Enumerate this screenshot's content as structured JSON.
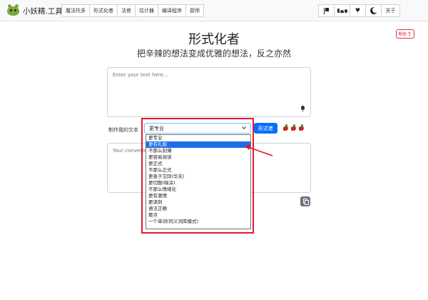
{
  "brand": {
    "name": "小妖精.工具",
    "logo_icon": "alien-logo-icon"
  },
  "nav": {
    "items": [
      "魔法托多",
      "形式化者",
      "法官",
      "估计器",
      "编译程序",
      "厨师"
    ],
    "right": {
      "language_icon": "flag-icon",
      "os_icon": "platforms-icon",
      "heart_icon": "heart-icon",
      "theme_icon": "moon-icon",
      "about": "关于"
    }
  },
  "help": {
    "label": "帮助❓"
  },
  "page": {
    "title": "形式化者",
    "subtitle": "把辛辣的想法变成优雅的想法，反之亦然"
  },
  "input": {
    "placeholder": "Enter your text here...",
    "mic_icon": "microphone-icon"
  },
  "controls": {
    "label": "制作我的文本",
    "selected": "更专业",
    "button": "形式者",
    "spice_level": 3
  },
  "dropdown_options": [
    "更专业",
    "更有礼貌",
    "不那么刻薄",
    "更容易阅读",
    "更正式",
    "不那么正式",
    "更善于交际(华夫)",
    "更切题(喘涂)",
    "不那么情绪化",
    "更有激情",
    "更讽刺",
    "语法正确",
    "要点",
    "一个单词(同义词库模式)"
  ],
  "highlighted_option": 1,
  "output": {
    "placeholder": "Your converted text...",
    "copy_icon": "copy-icon"
  },
  "colors": {
    "annotation": "#e0192f",
    "primary": "#0d6efd",
    "help": "#dc3545"
  }
}
